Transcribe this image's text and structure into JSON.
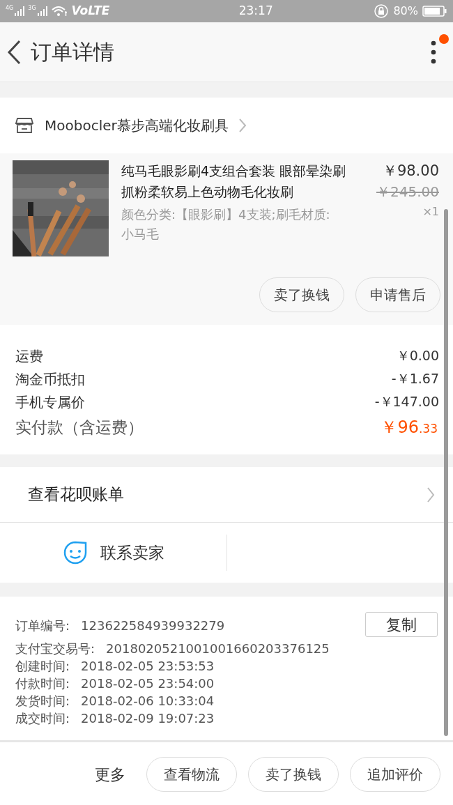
{
  "status_bar": {
    "network_1": "4G",
    "network_2": "3G",
    "volte": "VoLTE",
    "time": "23:17",
    "battery": "80%"
  },
  "header": {
    "title": "订单详情",
    "notification_dot": true
  },
  "store": {
    "name": "Moobocler慕步高端化妆刷具"
  },
  "product": {
    "title": "纯马毛眼影刷4支组合套装 眼部晕染刷抓粉柔软易上色动物毛化妆刷",
    "sku": "颜色分类:【眼影刷】4支装;刷毛材质:小马毛",
    "price": "￥98.00",
    "original_price": "￥245.00",
    "quantity": "×1",
    "buttons": [
      "卖了换钱",
      "申请售后"
    ]
  },
  "costs": [
    {
      "label": "运费",
      "value": "￥0.00"
    },
    {
      "label": "淘金币抵扣",
      "value": "-￥1.67"
    },
    {
      "label": "手机专属价",
      "value": "-￥147.00"
    }
  ],
  "total": {
    "label": "实付款（含运费）",
    "value": "￥96",
    "value_decimal": ".33"
  },
  "huabei": {
    "label": "查看花呗账单"
  },
  "contact": {
    "label": "联系卖家"
  },
  "order_info": {
    "copy_button": "复制",
    "rows": [
      {
        "label": "订单编号:",
        "value": "123622584939932279"
      },
      {
        "label": "支付宝交易号:",
        "value": "2018020521001001660203376125"
      },
      {
        "label": "创建时间:",
        "value": "2018-02-05 23:53:53"
      },
      {
        "label": "付款时间:",
        "value": "2018-02-05 23:54:00"
      },
      {
        "label": "发货时间:",
        "value": "2018-02-06 10:33:04"
      },
      {
        "label": "成交时间:",
        "value": "2018-02-09 19:07:23"
      }
    ]
  },
  "bottom_bar": {
    "more": "更多",
    "buttons": [
      "查看物流",
      "卖了换钱",
      "追加评价"
    ]
  }
}
